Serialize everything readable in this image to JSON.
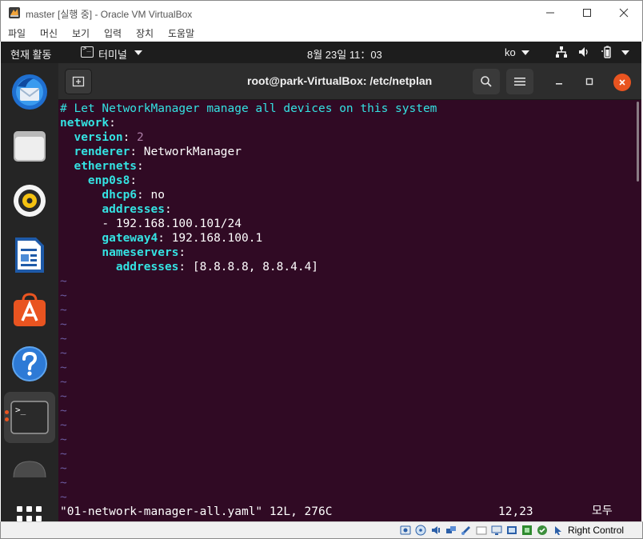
{
  "window": {
    "title": "master [실행 중] - Oracle VM VirtualBox",
    "menu": [
      "파일",
      "머신",
      "보기",
      "입력",
      "장치",
      "도움말"
    ]
  },
  "topbar": {
    "activities": "현재 활동",
    "app_name": "터미널",
    "clock": "8월 23일  11：03",
    "input_lang": "ko"
  },
  "dock": {
    "items": [
      "thunderbird-icon",
      "files-icon",
      "rhythmbox-icon",
      "libreoffice-writer-icon",
      "software-center-icon",
      "help-icon",
      "terminal-icon",
      "disc-icon",
      "app-grid-icon"
    ]
  },
  "terminal": {
    "title": "root@park-VirtualBox: /etc/netplan",
    "lines": {
      "l1": "# Let NetworkManager manage all devices on this system",
      "l2_key": "network",
      "l3_key": "version",
      "l3_val": "2",
      "l4_key": "renderer",
      "l4_val": "NetworkManager",
      "l5_key": "ethernets",
      "l6_key": "enp0s8",
      "l7_key": "dhcp6",
      "l7_val": "no",
      "l8_key": "addresses",
      "l9_val": "- 192.168.100.101/24",
      "l10_key": "gateway4",
      "l10_val": "192.168.100.1",
      "l11_key": "nameservers",
      "l12_key": "addresses",
      "l12_val": "[8.8.8.8, 8.8.4.4]"
    },
    "tilde": "~",
    "status_file": "\"01-network-manager-all.yaml\" 12L, 276C",
    "status_pos": "12,23",
    "status_scope": "모두"
  },
  "vbox_status": {
    "host_key": "Right Control"
  }
}
